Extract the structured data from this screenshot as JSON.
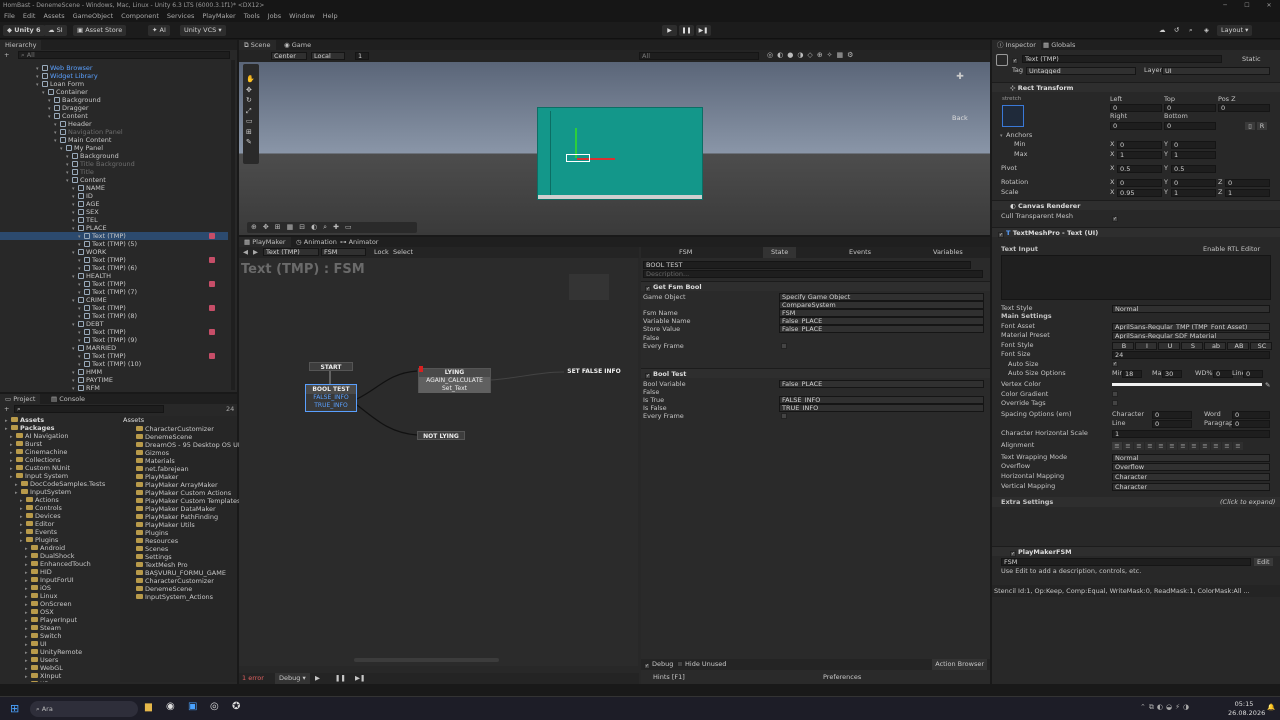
{
  "window": {
    "title": "HomBast - DenemeScene - Windows, Mac, Linux - Unity 6.3 LTS (6000.3.1f1)* <DX12>",
    "controls": [
      "─",
      "☐",
      "✕"
    ]
  },
  "menu": [
    "File",
    "Edit",
    "Assets",
    "GameObject",
    "Component",
    "Services",
    "PlayMaker",
    "Tools",
    "Jobs",
    "Window",
    "Help"
  ],
  "toolbar": {
    "unity": "Unity 6",
    "si": "SI",
    "asset_store": "Asset Store",
    "ai": "AI",
    "vcs": "Unity VCS",
    "layout": "Layout"
  },
  "hierarchy": {
    "title": "Hierarchy",
    "search_placeholder": "All",
    "rows": [
      {
        "d": 6,
        "t": "Web Browser",
        "s": "link",
        "e": 0
      },
      {
        "d": 6,
        "t": "Widget Library",
        "s": "link",
        "e": 0
      },
      {
        "d": 6,
        "t": "Loan Form",
        "s": "",
        "e": 0
      },
      {
        "d": 7,
        "t": "Container",
        "s": "",
        "e": 0
      },
      {
        "d": 8,
        "t": "Background",
        "s": "",
        "e": 0
      },
      {
        "d": 8,
        "t": "Dragger",
        "s": "",
        "e": 0
      },
      {
        "d": 8,
        "t": "Content",
        "s": "",
        "e": 0
      },
      {
        "d": 9,
        "t": "Header",
        "s": "",
        "e": 0
      },
      {
        "d": 9,
        "t": "Navigation Panel",
        "s": "dim",
        "e": 0
      },
      {
        "d": 9,
        "t": "Main Content",
        "s": "",
        "e": 0
      },
      {
        "d": 10,
        "t": "My Panel",
        "s": "",
        "e": 0
      },
      {
        "d": 11,
        "t": "Background",
        "s": "",
        "e": 0
      },
      {
        "d": 11,
        "t": "Title Background",
        "s": "dim",
        "e": 0
      },
      {
        "d": 11,
        "t": "Title",
        "s": "dim",
        "e": 0
      },
      {
        "d": 11,
        "t": "Content",
        "s": "",
        "e": 0
      },
      {
        "d": 12,
        "t": "NAME",
        "s": "",
        "e": 0
      },
      {
        "d": 12,
        "t": "ID",
        "s": "",
        "e": 0
      },
      {
        "d": 12,
        "t": "AGE",
        "s": "",
        "e": 0
      },
      {
        "d": 12,
        "t": "SEX",
        "s": "",
        "e": 0
      },
      {
        "d": 12,
        "t": "TEL",
        "s": "",
        "e": 0
      },
      {
        "d": 12,
        "t": "PLACE",
        "s": "",
        "e": 0
      },
      {
        "d": 13,
        "t": "Text (TMP)",
        "s": "hl",
        "e": 1
      },
      {
        "d": 13,
        "t": "Text (TMP) (5)",
        "s": "",
        "e": 0
      },
      {
        "d": 12,
        "t": "WORK",
        "s": "",
        "e": 0
      },
      {
        "d": 13,
        "t": "Text (TMP)",
        "s": "",
        "e": 1
      },
      {
        "d": 13,
        "t": "Text (TMP) (6)",
        "s": "",
        "e": 0
      },
      {
        "d": 12,
        "t": "HEALTH",
        "s": "",
        "e": 0
      },
      {
        "d": 13,
        "t": "Text (TMP)",
        "s": "",
        "e": 1
      },
      {
        "d": 13,
        "t": "Text (TMP) (7)",
        "s": "",
        "e": 0
      },
      {
        "d": 12,
        "t": "CRIME",
        "s": "",
        "e": 0
      },
      {
        "d": 13,
        "t": "Text (TMP)",
        "s": "",
        "e": 1
      },
      {
        "d": 13,
        "t": "Text (TMP) (8)",
        "s": "",
        "e": 0
      },
      {
        "d": 12,
        "t": "DEBT",
        "s": "",
        "e": 0
      },
      {
        "d": 13,
        "t": "Text (TMP)",
        "s": "",
        "e": 1
      },
      {
        "d": 13,
        "t": "Text (TMP) (9)",
        "s": "",
        "e": 0
      },
      {
        "d": 12,
        "t": "MARRIED",
        "s": "",
        "e": 0
      },
      {
        "d": 13,
        "t": "Text (TMP)",
        "s": "",
        "e": 1
      },
      {
        "d": 13,
        "t": "Text (TMP) (10)",
        "s": "",
        "e": 0
      },
      {
        "d": 12,
        "t": "HMM",
        "s": "",
        "e": 0
      },
      {
        "d": 12,
        "t": "PAYTIME",
        "s": "",
        "e": 0
      },
      {
        "d": 12,
        "t": "RFM",
        "s": "",
        "e": 0
      }
    ]
  },
  "project": {
    "tabs": [
      "Project",
      "Console"
    ],
    "count": "24",
    "tree": [
      {
        "d": 1,
        "t": "Assets",
        "b": 1
      },
      {
        "d": 1,
        "t": "Packages",
        "b": 1
      },
      {
        "d": 2,
        "t": "AI Navigation"
      },
      {
        "d": 2,
        "t": "Burst"
      },
      {
        "d": 2,
        "t": "Cinemachine"
      },
      {
        "d": 2,
        "t": "Collections"
      },
      {
        "d": 2,
        "t": "Custom NUnit"
      },
      {
        "d": 2,
        "t": "Input System"
      },
      {
        "d": 3,
        "t": "DocCodeSamples.Tests"
      },
      {
        "d": 3,
        "t": "InputSystem"
      },
      {
        "d": 4,
        "t": "Actions"
      },
      {
        "d": 4,
        "t": "Controls"
      },
      {
        "d": 4,
        "t": "Devices"
      },
      {
        "d": 4,
        "t": "Editor"
      },
      {
        "d": 4,
        "t": "Events"
      },
      {
        "d": 4,
        "t": "Plugins"
      },
      {
        "d": 5,
        "t": "Android"
      },
      {
        "d": 5,
        "t": "DualShock"
      },
      {
        "d": 5,
        "t": "EnhancedTouch"
      },
      {
        "d": 5,
        "t": "HID"
      },
      {
        "d": 5,
        "t": "InputForUI"
      },
      {
        "d": 5,
        "t": "iOS"
      },
      {
        "d": 5,
        "t": "Linux"
      },
      {
        "d": 5,
        "t": "OnScreen"
      },
      {
        "d": 5,
        "t": "OSX"
      },
      {
        "d": 5,
        "t": "PlayerInput"
      },
      {
        "d": 5,
        "t": "Steam"
      },
      {
        "d": 5,
        "t": "Switch"
      },
      {
        "d": 5,
        "t": "UI"
      },
      {
        "d": 5,
        "t": "UnityRemote"
      },
      {
        "d": 5,
        "t": "Users"
      },
      {
        "d": 5,
        "t": "WebGL"
      },
      {
        "d": 5,
        "t": "XInput"
      },
      {
        "d": 5,
        "t": "XR"
      }
    ],
    "assets_header": "Assets",
    "assets": [
      "CharacterCustomizer",
      "DenemeScene",
      "DreamOS - 95 Desktop OS UI",
      "Gizmos",
      "Materials",
      "net.fabrejean",
      "PlayMaker",
      "PlayMaker ArrayMaker",
      "PlayMaker Custom Actions",
      "PlayMaker Custom Templates",
      "PlayMaker DataMaker",
      "PlayMaker PathFinding",
      "PlayMaker Utils",
      "Plugins",
      "Resources",
      "Scenes",
      "Settings",
      "TextMesh Pro",
      "BAŞVURU_FORMU_GAME",
      "CharacterCustomizer",
      "DenemeScene",
      "InputSystem_Actions"
    ]
  },
  "scene": {
    "tabs": [
      "Scene",
      "Game"
    ],
    "pivot": "Center",
    "space": "Local",
    "snap": "1",
    "search_placeholder": "All",
    "view_label": "Back"
  },
  "playmaker": {
    "tabs": [
      "PlayMaker",
      "Animation",
      "Animator"
    ],
    "object": "Text (TMP)",
    "fsm": "FSM",
    "lock": "Lock",
    "select": "Select",
    "graph_title": "Text (TMP) : FSM",
    "start": "START",
    "bool_test": {
      "title": "BOOL TEST",
      "ev1": "FALSE_INFO",
      "ev2": "TRUE_INFO"
    },
    "lying": {
      "title": "LYING",
      "ev1": "AGAIN_CALCULATE",
      "ev2": "Set_Text"
    },
    "set_false": "SET FALSE INFO",
    "not_lying": "NOT LYING",
    "footer": {
      "errors": "1 error",
      "debug": "Debug",
      "hide": "Hide Unused",
      "browser": "Action Browser",
      "hints": "Hints [F1]",
      "prefs": "Preferences",
      "debug_chk": "Debug"
    },
    "state_tabs": [
      "FSM",
      "State",
      "Events",
      "Variables"
    ],
    "state_name": "BOOL TEST",
    "desc": "Description...",
    "a1": {
      "title": "Get Fsm Bool",
      "rows": [
        [
          "Game Object",
          "Specify Game Object"
        ],
        [
          "",
          "CompareSystem"
        ],
        [
          "Fsm Name",
          "FSM"
        ],
        [
          "Variable Name",
          "False_PLACE"
        ],
        [
          "Store Value",
          "False_PLACE"
        ],
        [
          "False",
          ""
        ],
        [
          "Every Frame",
          ""
        ]
      ]
    },
    "a2": {
      "title": "Bool Test",
      "rows": [
        [
          "Bool Variable",
          "False_PLACE"
        ],
        [
          "False",
          ""
        ],
        [
          "Is True",
          "FALSE_INFO"
        ],
        [
          "Is False",
          "TRUE_INFO"
        ],
        [
          "Every Frame",
          ""
        ]
      ]
    }
  },
  "inspector": {
    "tabs": [
      "Inspector",
      "Globals"
    ],
    "name": "Text (TMP)",
    "static": "Static",
    "tag": "Untagged",
    "layer": "UI",
    "tag_label": "Tag",
    "layer_label": "Layer",
    "rect": {
      "title": "Rect Transform",
      "stretch": "stretch",
      "cols": [
        "Left",
        "Top",
        "Pos Z"
      ],
      "vals": [
        "0",
        "0",
        "0"
      ],
      "cols2": [
        "Right",
        "Bottom"
      ],
      "vals2": [
        "0",
        "0"
      ],
      "anchors": "Anchors",
      "min": "Min",
      "max": "Max",
      "pivot": "Pivot",
      "rotation": "Rotation",
      "scale": "Scale",
      "min_v": [
        "0",
        "0"
      ],
      "max_v": [
        "1",
        "1"
      ],
      "pivot_v": [
        "0.5",
        "0.5"
      ],
      "rot_v": [
        "0",
        "0",
        "0"
      ],
      "scale_v": [
        "0.95",
        "1",
        "1"
      ],
      "R": "R"
    },
    "canvas_renderer": {
      "title": "Canvas Renderer",
      "cull": "Cull Transparent Mesh"
    },
    "tmp": {
      "title": "TextMeshPro - Text (UI)",
      "text_input": "Text Input",
      "rtl": "Enable RTL Editor",
      "text_style": [
        "Text Style",
        "Normal"
      ],
      "main": "Main Settings",
      "font_asset": [
        "Font Asset",
        "AprilSans-Regular_TMP (TMP_Font Asset)"
      ],
      "material": [
        "Material Preset",
        "AprilSans-Regular SDF Material"
      ],
      "font_style": "Font Style",
      "styles": [
        "B",
        "I",
        "U",
        "S",
        "ab",
        "AB",
        "SC"
      ],
      "font_size": [
        "Font Size",
        "24"
      ],
      "auto_size": "Auto Size",
      "auto_opts": "Auto Size Options",
      "min": "Min",
      "min_v": "18",
      "max": "Max",
      "max_v": "30",
      "wd": "WD%",
      "wd_v": "0",
      "line": "Line",
      "line_v": "0",
      "vertex": "Vertex Color",
      "gradient": "Color Gradient",
      "override": "Override Tags",
      "spacing": "Spacing Options (em)",
      "character": "Character",
      "char_v": "0",
      "word": "Word",
      "word_v": "0",
      "line2": "Line",
      "line2_v": "0",
      "paragraph": "Paragraph",
      "para_v": "0",
      "char_h_scale": [
        "Character Horizontal Scale",
        "1"
      ],
      "alignment": "Alignment",
      "wrap": [
        "Text Wrapping Mode",
        "Normal"
      ],
      "overflow": [
        "Overflow",
        "Overflow"
      ],
      "hmap": [
        "Horizontal Mapping",
        "Character"
      ],
      "vmap": [
        "Vertical Mapping",
        "Character"
      ],
      "extra": "Extra Settings",
      "expand": "(Click to expand)"
    },
    "pmfsm": {
      "title": "PlayMakerFSM",
      "fsm": "FSM",
      "edit": "Edit",
      "hint": "Use Edit to add a description, controls, etc."
    },
    "stencil": "Stencil Id:1, Op:Keep, Comp:Equal, WriteMask:0, ReadMask:1, ColorMask:All ..."
  },
  "taskbar": {
    "search": "Ara",
    "time": "05:15",
    "date": "26.08.2026"
  },
  "colors": {
    "accent": "#3a79d8",
    "scene_panel": "#13978a",
    "error": "#c74e68"
  }
}
